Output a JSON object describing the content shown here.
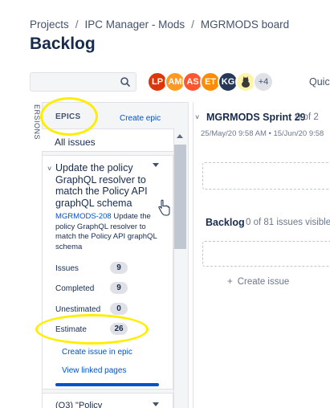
{
  "breadcrumb": {
    "items": [
      "Projects",
      "IPC Manager - Mods",
      "MGRMODS board"
    ]
  },
  "page_title": "Backlog",
  "search": {
    "placeholder": "",
    "icon": "search-icon"
  },
  "avatars": [
    {
      "initials": "LP",
      "color": "#de350b"
    },
    {
      "initials": "AM",
      "color": "#ff991f"
    },
    {
      "initials": "AS",
      "color": "#ff5630"
    },
    {
      "initials": "ET",
      "color": "#ff8b00"
    },
    {
      "initials": "KG",
      "color": "#253858"
    },
    {
      "initials": "",
      "color": "#fff4a8",
      "icon": "cat-avatar-icon"
    },
    {
      "initials": "+4",
      "color": "#dfe1e6"
    }
  ],
  "quick_filters_label": "Quicl",
  "versions_tab_label": "ERSIONS",
  "epics_panel": {
    "header_label": "EPICS",
    "create_epic_label": "Create epic",
    "all_issues_label": "All issues",
    "epic": {
      "title": "Update the policy GraphQL resolver to match the Policy API graphQL schema",
      "key": "MGRMODS-208",
      "description": "Update the policy GraphQL resolver to match the Policy API graphQL schema",
      "stats": [
        {
          "label": "Issues",
          "value": "9"
        },
        {
          "label": "Completed",
          "value": "9"
        },
        {
          "label": "Unestimated",
          "value": "0"
        },
        {
          "label": "Estimate",
          "value": "26"
        }
      ],
      "create_issue_link": "Create issue in epic",
      "view_linked_pages_link": "View linked pages",
      "progress_fraction": 1.0
    },
    "next_epic_title": "(Q3) \"Policy"
  },
  "sprint": {
    "title": "MGRMODS Sprint 29",
    "count": "0 of 2",
    "dates": "25/May/20 9:58 AM • 15/Jun/20 9:58"
  },
  "backlog": {
    "title": "Backlog",
    "count": "0 of 81 issues visible",
    "create_issue_label": "Create issue"
  },
  "colors": {
    "link": "#0052cc",
    "highlight": "#ffee00"
  }
}
